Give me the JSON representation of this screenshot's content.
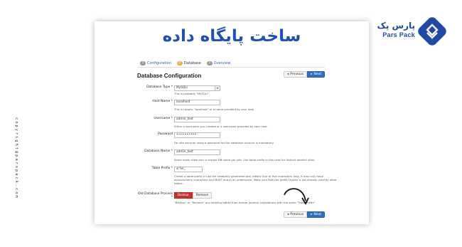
{
  "side_text": "copyright@parspack.com",
  "brand": {
    "name_fa": "پارس پک",
    "name_en": "Pars Pack",
    "color": "#1d4aa6"
  },
  "hero_title": "ساخت پایگاه داده",
  "steps": [
    {
      "num": "1",
      "label": "Configuration"
    },
    {
      "num": "2",
      "label": "Database"
    },
    {
      "num": "3",
      "label": "Overview"
    }
  ],
  "section_title": "Database Configuration",
  "nav": {
    "previous": "Previous",
    "next": "Next"
  },
  "form": {
    "db_type": {
      "label": "Database Type *",
      "value": "MySQLi",
      "help": "This is probably \"MySQLi\"."
    },
    "host": {
      "label": "Host Name *",
      "value": "localhost",
      "help": "This is usually \"localhost\" or a name provided by your host."
    },
    "username": {
      "label": "Username *",
      "value": "admin_test",
      "help": "Either a username you created or a username provided by your host."
    },
    "password": {
      "label": "Password",
      "value": "••••••••••",
      "help": "For site security using a password for the database account is mandatory."
    },
    "db_name": {
      "label": "Database Name *",
      "value": "admin_test",
      "help": "Some hosts allow only a certain DB name per site. Use table prefix in this case for distinct Joomla! sites."
    },
    "prefix": {
      "label": "Table Prefix *",
      "value": "sr7ei_",
      "help": "Create a table prefix or use the randomly generated one. Ideally four or five characters long, it may only have alphanumeric characters and MUST end in an underscore. Make sure that the prefix chosen is not already used by other tables."
    },
    "old_db": {
      "label": "Old Database Process *",
      "option_on": "Backup",
      "option_off": "Remove",
      "help": "\"Backup\" or \"Remove\" any existing tables from former Joomla! installations with the same \"Table Prefix\"."
    }
  }
}
